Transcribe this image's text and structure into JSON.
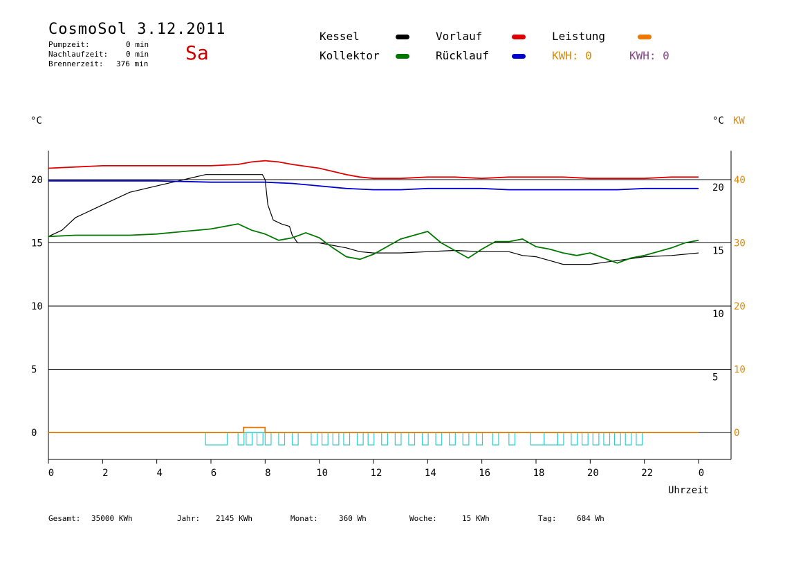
{
  "header": {
    "title": "CosmoSol 3.12.2011",
    "weekday": "Sa",
    "weekday_color": "#cc0000",
    "stats": [
      {
        "label": "Pumpzeit:",
        "value": "0 min"
      },
      {
        "label": "Nachlaufzeit:",
        "value": "0 min"
      },
      {
        "label": "Brennerzeit:",
        "value": "376 min"
      }
    ]
  },
  "legend": {
    "items": [
      {
        "label": "Kessel",
        "color": "#000000"
      },
      {
        "label": "Kollektor",
        "color": "#007700"
      },
      {
        "label": "Vorlauf",
        "color": "#dd0000"
      },
      {
        "label": "Rücklauf",
        "color": "#0000cc"
      },
      {
        "label": "Leistung",
        "color": "#ee7700"
      }
    ],
    "kwh_orange": {
      "text": "KWH: 0",
      "color": "#dd8800"
    },
    "kwh_purple": {
      "text": "KWH: 0",
      "color": "#884488"
    }
  },
  "axes": {
    "y_left_unit": "°C",
    "y_right_unit": "°C",
    "y_right2_unit": "KW",
    "x_label": "Uhrzeit",
    "x_ticks": [
      "0",
      "2",
      "4",
      "6",
      "8",
      "10",
      "12",
      "14",
      "16",
      "18",
      "20",
      "22",
      "0"
    ],
    "y_left_ticks": [
      "20",
      "15",
      "10",
      "5",
      "0"
    ],
    "y_right_ticks": [
      "20",
      "15",
      "10",
      "5"
    ],
    "y_right2_ticks": [
      "40",
      "30",
      "20",
      "10",
      "0"
    ]
  },
  "chart_data": {
    "type": "line",
    "x_unit": "hour",
    "xlim": [
      0,
      24.5
    ],
    "ylim": [
      -2,
      22
    ],
    "series": [
      {
        "name": "Kessel",
        "color": "#000000",
        "x": [
          0,
          0.5,
          1,
          2,
          3,
          4,
          5,
          5.8,
          6.5,
          7.5,
          7.9,
          8.0,
          8.1,
          8.3,
          8.6,
          8.9,
          9.0,
          9.2,
          9.5,
          10,
          11,
          11.5,
          12,
          13,
          14,
          15,
          16,
          17,
          17.5,
          18,
          18.5,
          19,
          20,
          21,
          22,
          23,
          24
        ],
        "y": [
          15.5,
          16,
          17,
          18,
          19,
          19.5,
          20,
          20.4,
          20.4,
          20.4,
          20.4,
          20,
          18,
          16.8,
          16.5,
          16.3,
          15.6,
          15.0,
          15.0,
          15.0,
          14.6,
          14.3,
          14.2,
          14.2,
          14.3,
          14.4,
          14.3,
          14.3,
          14.0,
          13.9,
          13.6,
          13.3,
          13.3,
          13.6,
          13.9,
          14.0,
          14.2
        ]
      },
      {
        "name": "Kollektor",
        "color": "#007700",
        "x": [
          0,
          1,
          2,
          3,
          4,
          5,
          6,
          6.5,
          7,
          7.5,
          8,
          8.5,
          9,
          9.5,
          10,
          10.5,
          11,
          11.5,
          12,
          13,
          14,
          14.5,
          15,
          15.5,
          16,
          16.5,
          17,
          17.5,
          18,
          18.5,
          19,
          19.5,
          20,
          20.5,
          21,
          21.5,
          22,
          22.5,
          23,
          23.5,
          24
        ],
        "y": [
          15.5,
          15.6,
          15.6,
          15.6,
          15.7,
          15.9,
          16.1,
          16.3,
          16.5,
          16.0,
          15.7,
          15.2,
          15.4,
          15.8,
          15.4,
          14.6,
          13.9,
          13.7,
          14.1,
          15.3,
          15.9,
          15.0,
          14.4,
          13.8,
          14.5,
          15.1,
          15.1,
          15.3,
          14.7,
          14.5,
          14.2,
          14.0,
          14.2,
          13.8,
          13.4,
          13.8,
          14.0,
          14.3,
          14.6,
          15.0,
          15.2
        ]
      },
      {
        "name": "Vorlauf",
        "color": "#dd0000",
        "x": [
          0,
          2,
          4,
          6,
          7,
          7.5,
          8,
          8.5,
          9,
          10,
          11,
          11.5,
          12,
          13,
          14,
          15,
          16,
          17,
          18,
          19,
          20,
          21,
          22,
          23,
          24
        ],
        "y": [
          20.9,
          21.1,
          21.1,
          21.1,
          21.2,
          21.4,
          21.5,
          21.4,
          21.2,
          20.9,
          20.4,
          20.2,
          20.1,
          20.1,
          20.2,
          20.2,
          20.1,
          20.2,
          20.2,
          20.2,
          20.1,
          20.1,
          20.1,
          20.2,
          20.2
        ]
      },
      {
        "name": "Rücklauf",
        "color": "#0000cc",
        "x": [
          0,
          2,
          4,
          6,
          8,
          9,
          10,
          11,
          12,
          13,
          14,
          15,
          16,
          17,
          18,
          19,
          20,
          21,
          22,
          23,
          24
        ],
        "y": [
          19.9,
          19.9,
          19.9,
          19.8,
          19.8,
          19.7,
          19.5,
          19.3,
          19.2,
          19.2,
          19.3,
          19.3,
          19.3,
          19.2,
          19.2,
          19.2,
          19.2,
          19.2,
          19.3,
          19.3,
          19.3
        ]
      },
      {
        "name": "Leistung",
        "color": "#ee7700",
        "x": [
          0,
          7.2,
          7.2,
          8.0,
          8.0,
          24
        ],
        "y": [
          0,
          0,
          0.4,
          0.4,
          0,
          0
        ]
      }
    ],
    "pump_pulses_hours": [
      5.8,
      7.0,
      7.3,
      7.7,
      8.0,
      8.5,
      9.0,
      9.7,
      10.1,
      10.5,
      10.9,
      11.4,
      11.8,
      12.3,
      12.8,
      13.3,
      13.8,
      14.3,
      14.8,
      15.3,
      15.8,
      16.4,
      17.0,
      17.8,
      18.3,
      18.8,
      19.3,
      19.7,
      20.1,
      20.5,
      20.9,
      21.3,
      21.7
    ],
    "pump_color": "#33cccc"
  },
  "footer": {
    "items": [
      {
        "label": "Gesamt:",
        "value": "35000 KWh"
      },
      {
        "label": "Jahr:",
        "value": "2145 KWh"
      },
      {
        "label": "Monat:",
        "value": "360 Wh"
      },
      {
        "label": "Woche:",
        "value": "15 KWh"
      },
      {
        "label": "Tag:",
        "value": "684 Wh"
      }
    ]
  }
}
